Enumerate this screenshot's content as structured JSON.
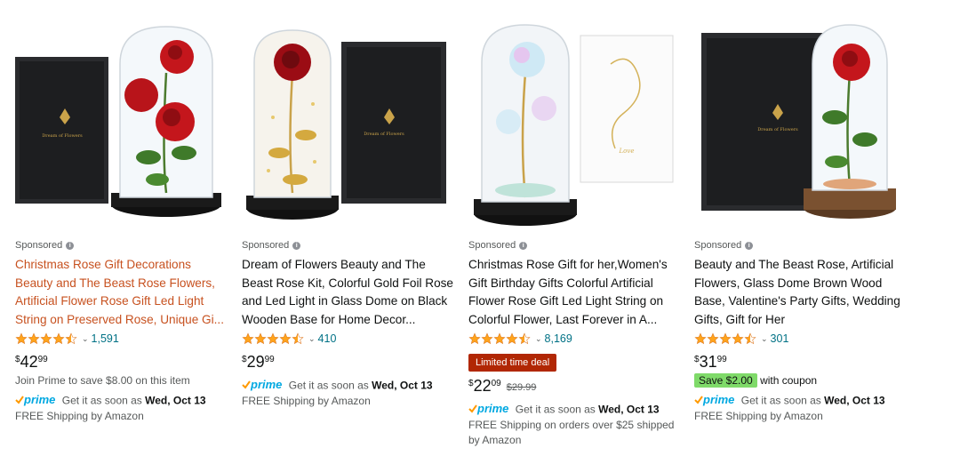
{
  "sponsored_label": "Sponsored",
  "products": [
    {
      "title": "Christmas Rose Gift Decorations Beauty and The Beast Rose Flowers, Artificial Flower Rose Gift Led Light String on Preserved Rose, Unique Gi...",
      "rating_count": "1,591",
      "price_symbol": "$",
      "price_whole": "42",
      "price_frac": "99",
      "prime_offer": "Join Prime to save $8.00 on this item",
      "delivery_prefix": "Get it as soon as",
      "delivery_date": "Wed, Oct 13",
      "shipping": "FREE Shipping by Amazon"
    },
    {
      "title": "Dream of Flowers Beauty and The Beast Rose Kit, Colorful Gold Foil Rose and Led Light in Glass Dome on Black Wooden Base for Home Decor...",
      "rating_count": "410",
      "price_symbol": "$",
      "price_whole": "29",
      "price_frac": "99",
      "delivery_prefix": "Get it as soon as",
      "delivery_date": "Wed, Oct 13",
      "shipping": "FREE Shipping by Amazon"
    },
    {
      "title": "Christmas Rose Gift for her,Women's Gift Birthday Gifts Colorful Artificial Flower Rose Gift Led Light String on Colorful Flower, Last Forever in A...",
      "rating_count": "8,169",
      "deal_badge": "Limited time deal",
      "price_symbol": "$",
      "price_whole": "22",
      "price_frac": "09",
      "list_price": "$29.99",
      "delivery_prefix": "Get it as soon as",
      "delivery_date": "Wed, Oct 13",
      "shipping_line1": "FREE Shipping on orders over $25 shipped",
      "shipping_line2": "by Amazon"
    },
    {
      "title": "Beauty and The Beast Rose, Artificial Flowers, Glass Dome Brown Wood Base, Valentine's Party Gifts, Wedding Gifts, Gift for Her",
      "rating_count": "301",
      "price_symbol": "$",
      "price_whole": "31",
      "price_frac": "99",
      "coupon_badge": "Save $2.00",
      "coupon_suffix": "with coupon",
      "delivery_prefix": "Get it as soon as",
      "delivery_date": "Wed, Oct 13",
      "shipping": "FREE Shipping by Amazon"
    }
  ],
  "prime_label": "prime",
  "brand_box_text": "Dream of Flowers",
  "colors": {
    "link_highlight": "#c7511f",
    "rating_link": "#007185",
    "star": "#ffa41c",
    "deal_badge": "#b12704",
    "coupon_badge": "#7fda69",
    "prime_blue": "#00a8e1",
    "prime_check": "#ff9900"
  }
}
